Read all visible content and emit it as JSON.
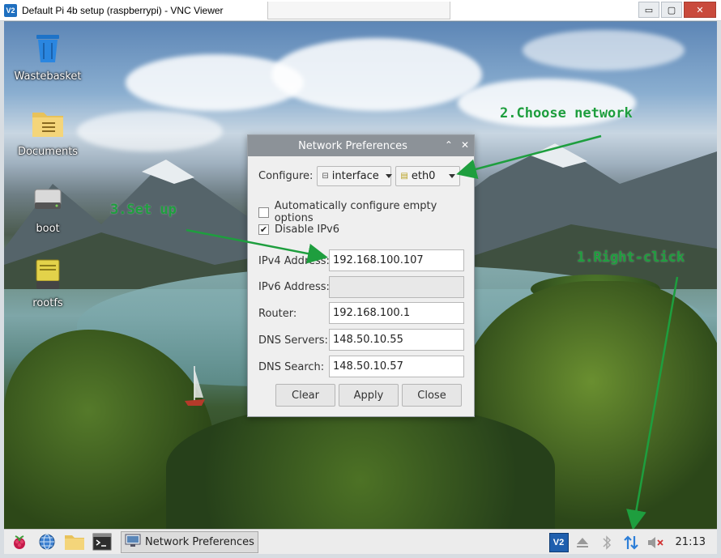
{
  "window": {
    "title": "Default Pi 4b setup (raspberrypi) - VNC Viewer",
    "logo_text": "V2",
    "controls": [
      "▭",
      "▢",
      "✕"
    ]
  },
  "desktop": {
    "icons": [
      {
        "label": "Wastebasket",
        "icon": "wastebasket-icon"
      },
      {
        "label": "Documents",
        "icon": "folder-icon"
      },
      {
        "label": "boot",
        "icon": "drive-icon"
      },
      {
        "label": "rootfs",
        "icon": "drive-icon"
      }
    ]
  },
  "dialog": {
    "title": "Network Preferences",
    "configure_label": "Configure:",
    "configure_type": "interface",
    "configure_interface": "eth0",
    "auto_configure_label": "Automatically configure empty options",
    "auto_configure_checked": false,
    "disable_ipv6_label": "Disable IPv6",
    "disable_ipv6_checked": true,
    "fields": [
      {
        "label": "IPv4 Address:",
        "value": "192.168.100.107",
        "enabled": true
      },
      {
        "label": "IPv6 Address:",
        "value": "",
        "enabled": false
      },
      {
        "label": "Router:",
        "value": "192.168.100.1",
        "enabled": true
      },
      {
        "label": "DNS Servers:",
        "value": "148.50.10.55",
        "enabled": true
      },
      {
        "label": "DNS Search:",
        "value": "148.50.10.57",
        "enabled": true
      }
    ],
    "buttons": {
      "clear": "Clear",
      "apply": "Apply",
      "close": "Close"
    },
    "title_controls": {
      "minimize": "⌃",
      "close": "✕"
    }
  },
  "annotations": {
    "step1": "1.Right-click",
    "step2": "2.Choose network",
    "step3": "3.Set up"
  },
  "annotation_color": "#1e9e3e",
  "taskbar": {
    "task_label": "Network Preferences",
    "clock": "21:13",
    "tray_vnc_text": "V2"
  }
}
